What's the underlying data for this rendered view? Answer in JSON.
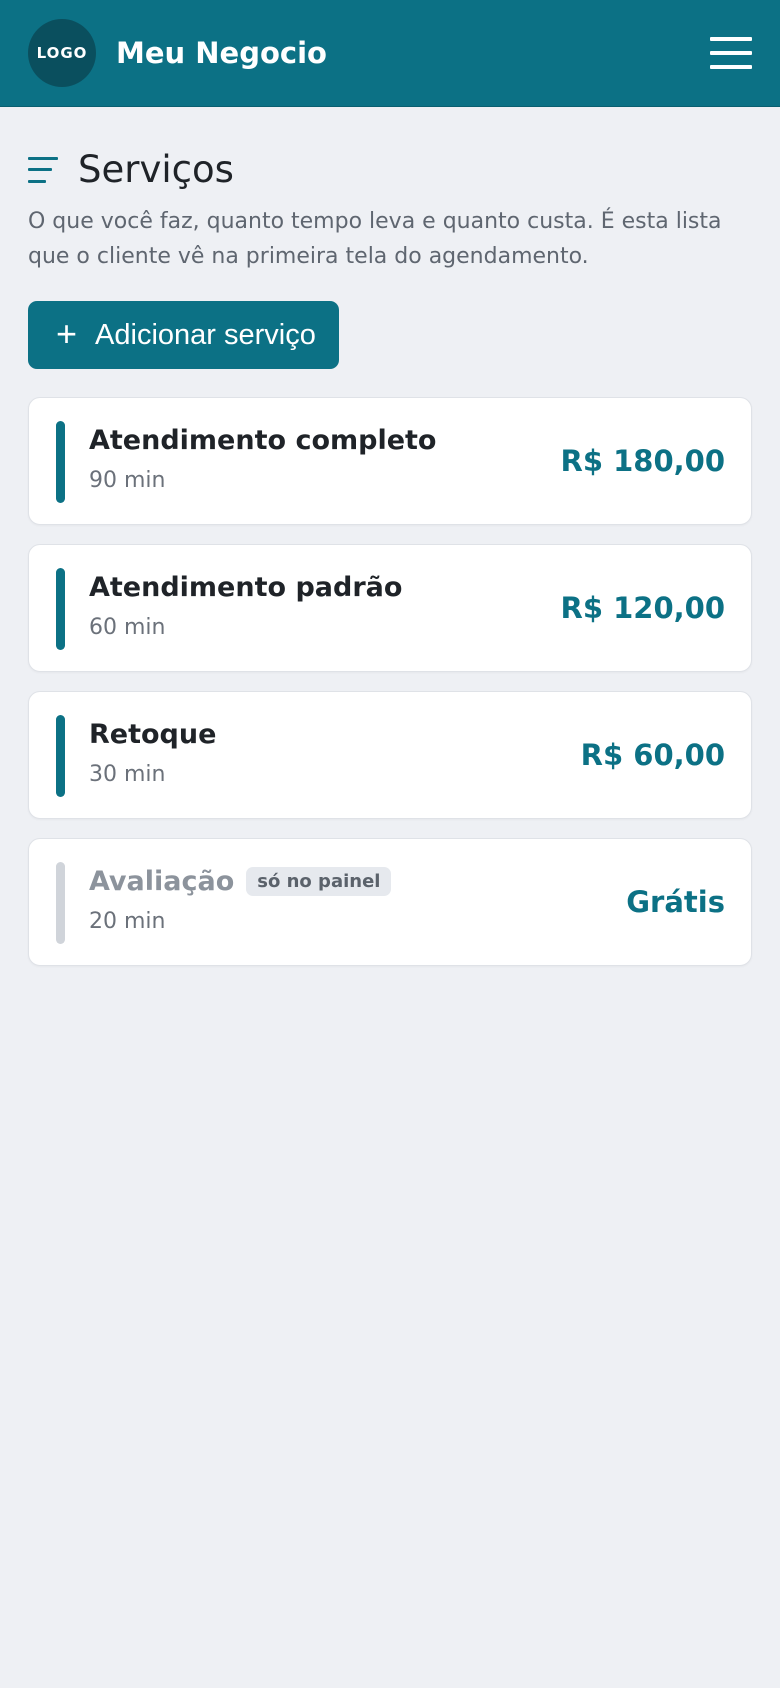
{
  "header": {
    "logo_text": "LOGO",
    "app_name": "Meu Negocio",
    "menu_icon": "hamburger-menu-icon",
    "colors": {
      "primary": "#0c7185"
    }
  },
  "page": {
    "title": "Serviços",
    "title_icon": "list-icon",
    "description": "O que você faz, quanto tempo leva e quanto custa. É esta lista que o cliente vê na primeira tela do agendamento."
  },
  "add_button": {
    "icon": "+",
    "label": "Adicionar serviço"
  },
  "services": [
    {
      "name": "Atendimento completo",
      "duration": "90 min",
      "price": "R$ 180,00",
      "badge": ""
    },
    {
      "name": "Atendimento padrão",
      "duration": "60 min",
      "price": "R$ 120,00",
      "badge": ""
    },
    {
      "name": "Retoque",
      "duration": "30 min",
      "price": "R$ 60,00",
      "badge": ""
    },
    {
      "name": "Avaliação",
      "duration": "20 min",
      "price": "Grátis",
      "badge": "só no painel"
    }
  ]
}
